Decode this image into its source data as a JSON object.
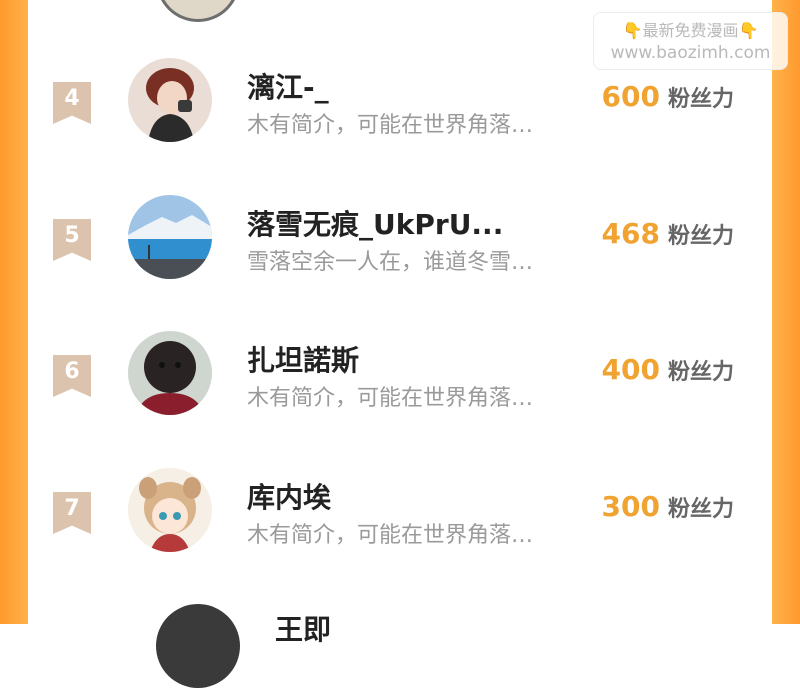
{
  "watermark": {
    "line1": "最新免费漫画",
    "line2": "www.baozimh.com",
    "icon": "pointing-down-hand-icon"
  },
  "fans_label": "粉丝力",
  "colors": {
    "frame": "#ff9a2e",
    "rank_badge": "#dcc3ad",
    "fans_number": "#f0a330",
    "bio_text": "#9a9a9a"
  },
  "list": [
    {
      "rank": "4",
      "name": "漓江-_",
      "bio": "木有简介，可能在世界角落…",
      "fans": "600"
    },
    {
      "rank": "5",
      "name": "落雪无痕_UkPrU...",
      "bio": "雪落空余一人在，谁道冬雪…",
      "fans": "468"
    },
    {
      "rank": "6",
      "name": "扎坦諾斯",
      "bio": "木有简介，可能在世界角落…",
      "fans": "400"
    },
    {
      "rank": "7",
      "name": "库内埃",
      "bio": "木有简介，可能在世界角落…",
      "fans": "300"
    }
  ],
  "partial_bottom": {
    "name": "王即"
  }
}
